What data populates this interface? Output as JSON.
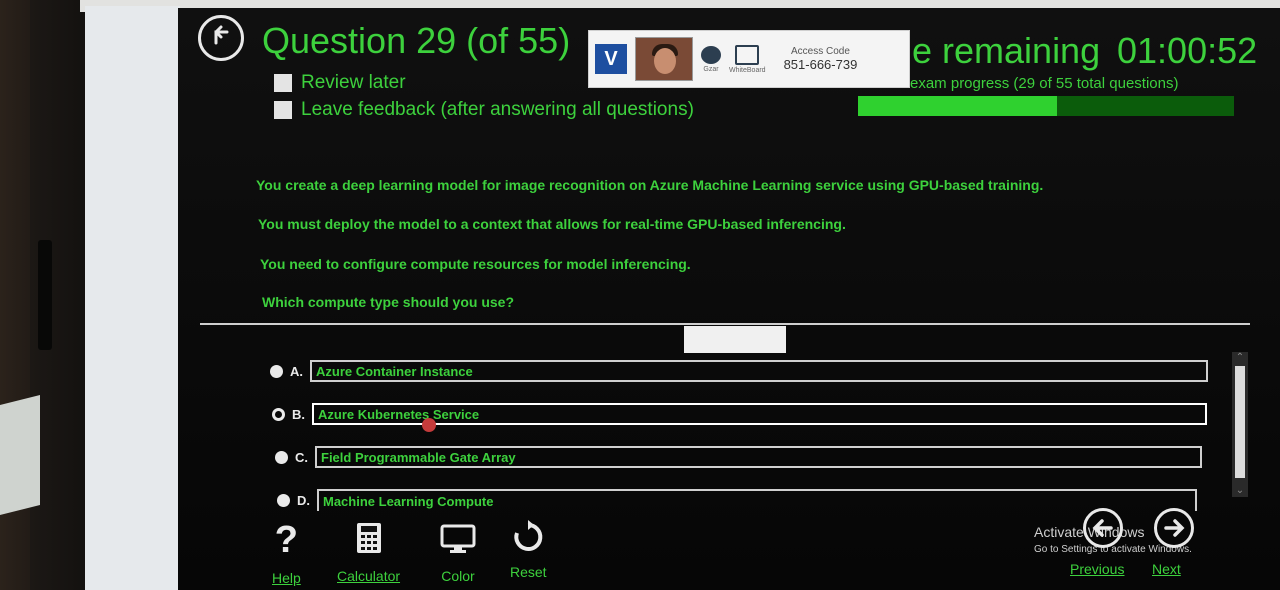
{
  "header": {
    "question_title": "Question 29 (of 55)",
    "review_later": "Review later",
    "leave_feedback": "Leave feedback (after answering all questions)",
    "time_label": "e remaining",
    "time_value": "01:00:52",
    "progress_label": "exam progress (29 of 55 total questions)",
    "progress_fraction": 0.53
  },
  "proctor": {
    "chat_label": "Gzar",
    "whiteboard_label": "WhiteBoard",
    "access_code_label": "Access Code",
    "access_code": "851-666-739"
  },
  "question": {
    "lines": [
      "You create a deep learning model for image recognition on Azure Machine Learning service using GPU-based training.",
      "You must deploy the model to a context that allows for real-time GPU-based inferencing.",
      "You need to configure compute resources for model inferencing.",
      "Which compute type should you use?"
    ]
  },
  "options": [
    {
      "letter": "A.",
      "text": "Azure Container Instance"
    },
    {
      "letter": "B.",
      "text": "Azure Kubernetes Service"
    },
    {
      "letter": "C.",
      "text": "Field Programmable Gate Array"
    },
    {
      "letter": "D.",
      "text": "Machine Learning Compute"
    }
  ],
  "footer": {
    "help": "Help",
    "calculator": "Calculator",
    "color": "Color",
    "reset": "Reset",
    "previous": "Previous",
    "next": "Next",
    "activate_title": "Activate Windows",
    "activate_sub": "Go to Settings to activate Windows."
  },
  "colors": {
    "accent_green": "#3dd13d",
    "background": "#060606",
    "progress_track": "#0b5c0b"
  },
  "icons": [
    "back-arrow-icon",
    "question-mark-icon",
    "calculator-icon",
    "monitor-icon",
    "reset-icon",
    "previous-arrow-icon",
    "next-arrow-icon"
  ]
}
